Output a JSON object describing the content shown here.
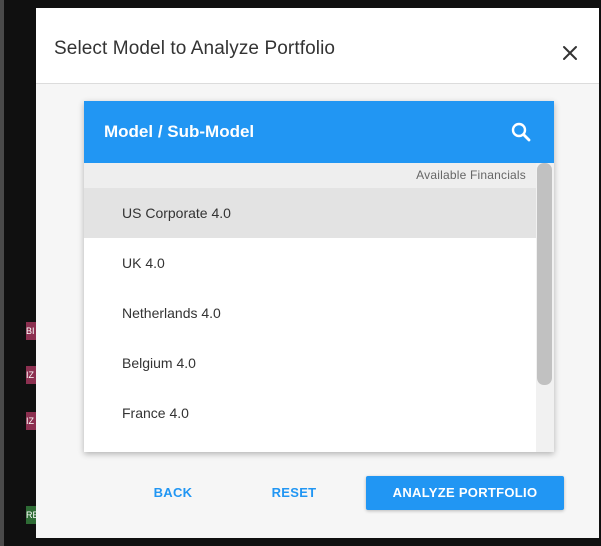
{
  "background": {
    "tags": [
      {
        "text": "BI",
        "color": "#8c3050"
      },
      {
        "text": "IZ",
        "color": "#8c3050"
      },
      {
        "text": "IZ",
        "color": "#8c3050"
      },
      {
        "text": "RE",
        "color": "#2e6b35"
      }
    ]
  },
  "dialog": {
    "title": "Select Model to Analyze Portfolio",
    "close_icon": "close-icon"
  },
  "picker": {
    "title": "Model / Sub-Model",
    "search_icon": "search-icon",
    "group_label": "Available Financials",
    "items": [
      {
        "label": "US Corporate 4.0",
        "selected": true
      },
      {
        "label": "UK 4.0",
        "selected": false
      },
      {
        "label": "Netherlands 4.0",
        "selected": false
      },
      {
        "label": "Belgium 4.0",
        "selected": false
      },
      {
        "label": "France 4.0",
        "selected": false
      }
    ]
  },
  "footer": {
    "back_label": "BACK",
    "reset_label": "RESET",
    "analyze_label": "ANALYZE PORTFOLIO"
  },
  "colors": {
    "accent": "#2196f3",
    "selected_row": "#e3e3e3"
  }
}
